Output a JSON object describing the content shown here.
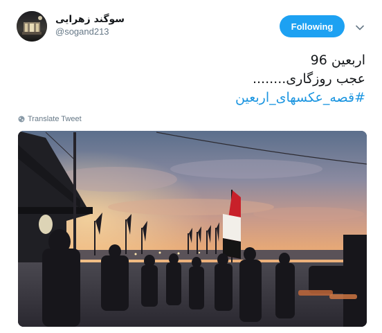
{
  "user": {
    "display_name": "سوگند زهرایی",
    "screen_name": "@sogand213"
  },
  "actions": {
    "follow_label": "Following",
    "menu_icon": "chevron-down-icon"
  },
  "tweet": {
    "lines": [
      "اربعین 96",
      "عجب روزگاری........"
    ],
    "hashtag": "#قصه_عکسهای_اربعین",
    "translate_label": "Translate Tweet"
  },
  "colors": {
    "accent": "#1da1f2",
    "hashtag": "#1b95e0",
    "secondary_text": "#657786",
    "primary_text": "#14171a"
  },
  "media": {
    "icon": "photo-sunset-procession-with-flags"
  }
}
